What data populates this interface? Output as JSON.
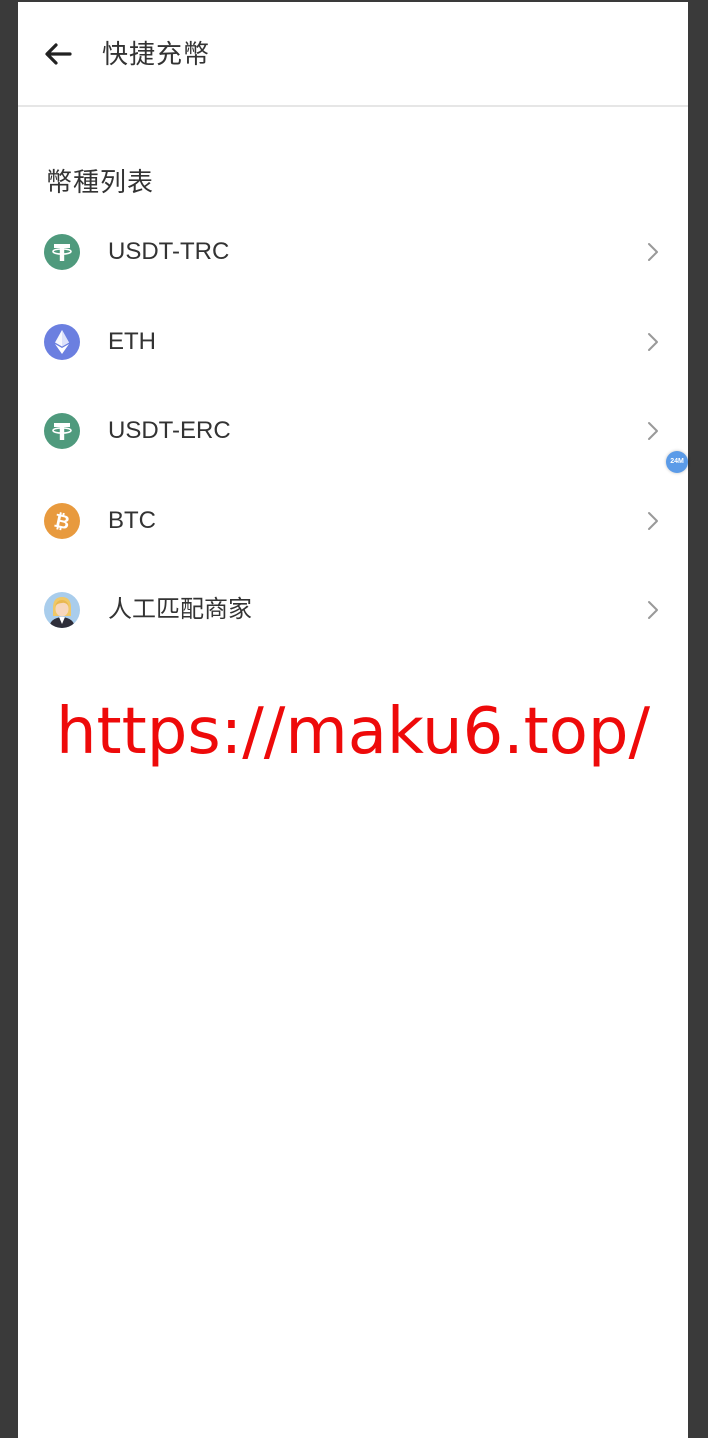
{
  "header": {
    "title": "快捷充幣",
    "back_icon": "arrow-left-icon"
  },
  "section": {
    "title": "幣種列表"
  },
  "coins": [
    {
      "label": "USDT-TRC",
      "icon": "tether-icon",
      "color": "#4f9a7d"
    },
    {
      "label": "ETH",
      "icon": "ethereum-icon",
      "color": "#6b7fe0"
    },
    {
      "label": "USDT-ERC",
      "icon": "tether-icon",
      "color": "#4f9a7d"
    },
    {
      "label": "BTC",
      "icon": "bitcoin-icon",
      "color": "#e89a3e"
    },
    {
      "label": "人工匹配商家",
      "icon": "agent-avatar-icon",
      "color": "#9ec6e8"
    }
  ],
  "watermark": {
    "text": "https://maku6.top/",
    "color": "#ee0a0a"
  },
  "side_badge": {
    "text": "24M",
    "color": "#5b9be8"
  }
}
